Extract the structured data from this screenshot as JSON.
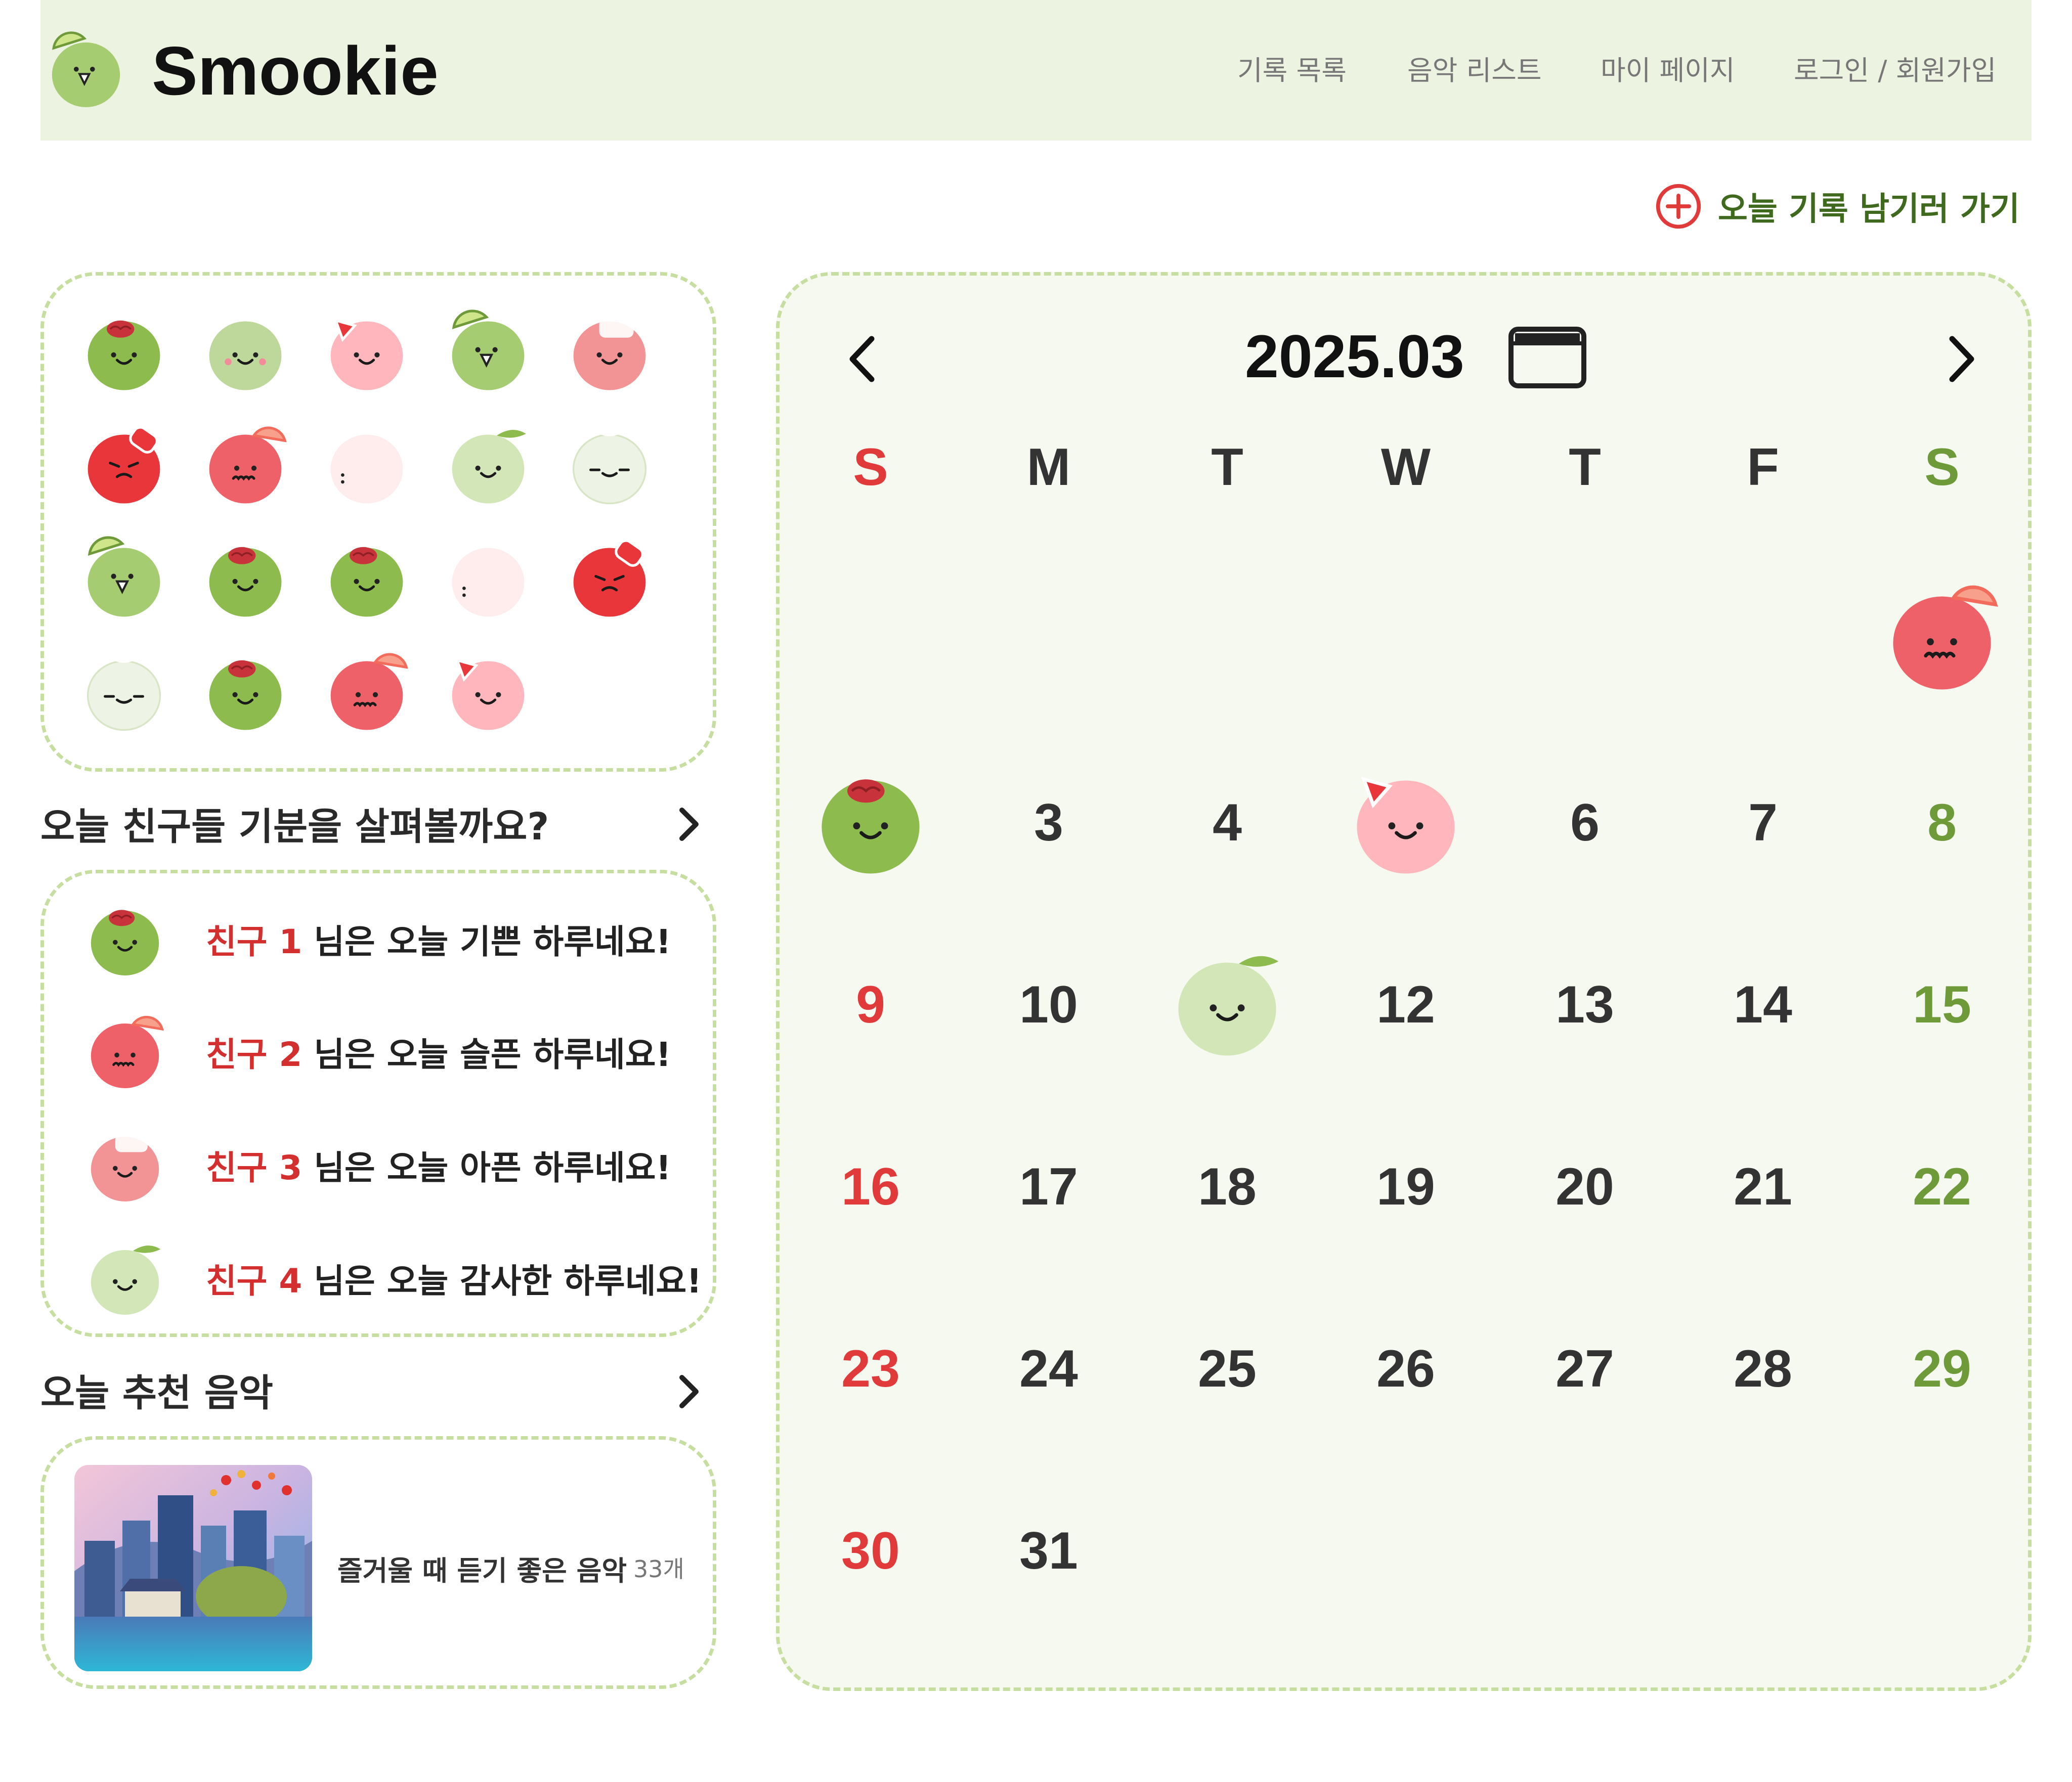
{
  "app": {
    "title": "Smookie"
  },
  "nav": [
    {
      "label": "기록 목록"
    },
    {
      "label": "음악 리스트"
    },
    {
      "label": "마이 페이지"
    },
    {
      "label": "로그인 / 회원가입"
    }
  ],
  "add_record": {
    "label": "오늘 기록 남기러 가기",
    "icon": "plus-circle-icon"
  },
  "mood_grid": {
    "moods": [
      "happy",
      "calm",
      "strawberry",
      "lime",
      "sick",
      "angry",
      "grapefruit",
      "faint",
      "thankful",
      "peaceful",
      "lime",
      "happy",
      "happy",
      "faint",
      "angry",
      "peaceful",
      "happy",
      "grapefruit",
      "strawberry"
    ]
  },
  "friends_section": {
    "title": "오늘 친구들 기분을 살펴볼까요?"
  },
  "friends": [
    {
      "name": "친구 1",
      "text": " 님은 오늘 기쁜 하루네요!",
      "mood": "happy"
    },
    {
      "name": "친구 2",
      "text": " 님은 오늘 슬픈 하루네요!",
      "mood": "grapefruit"
    },
    {
      "name": "친구 3",
      "text": " 님은 오늘 아픈 하루네요!",
      "mood": "sick"
    },
    {
      "name": "친구 4",
      "text": " 님은 오늘 감사한 하루네요!",
      "mood": "thankful"
    }
  ],
  "music_section": {
    "title": "오늘 추천 음악"
  },
  "music": {
    "title": "즐거울 때 듣기 좋은 음악",
    "count": "33개"
  },
  "calendar": {
    "month_label": "2025.03",
    "weekdays": [
      "S",
      "M",
      "T",
      "W",
      "T",
      "F",
      "S"
    ],
    "first_weekday": 6,
    "days_in_month": 31,
    "mood_days": [
      {
        "day": 1,
        "mood": "grapefruit"
      },
      {
        "day": 2,
        "mood": "happy"
      },
      {
        "day": 5,
        "mood": "strawberry"
      },
      {
        "day": 11,
        "mood": "thankful"
      }
    ]
  },
  "colors": {
    "accent_green": "#6E9A3A",
    "sunday_red": "#E03A3A",
    "friend_name_red": "#D32F2F",
    "header_bg": "#EDF3E1",
    "calendar_bg": "#F6F9F0",
    "dashed_border": "#C6DFA0"
  }
}
